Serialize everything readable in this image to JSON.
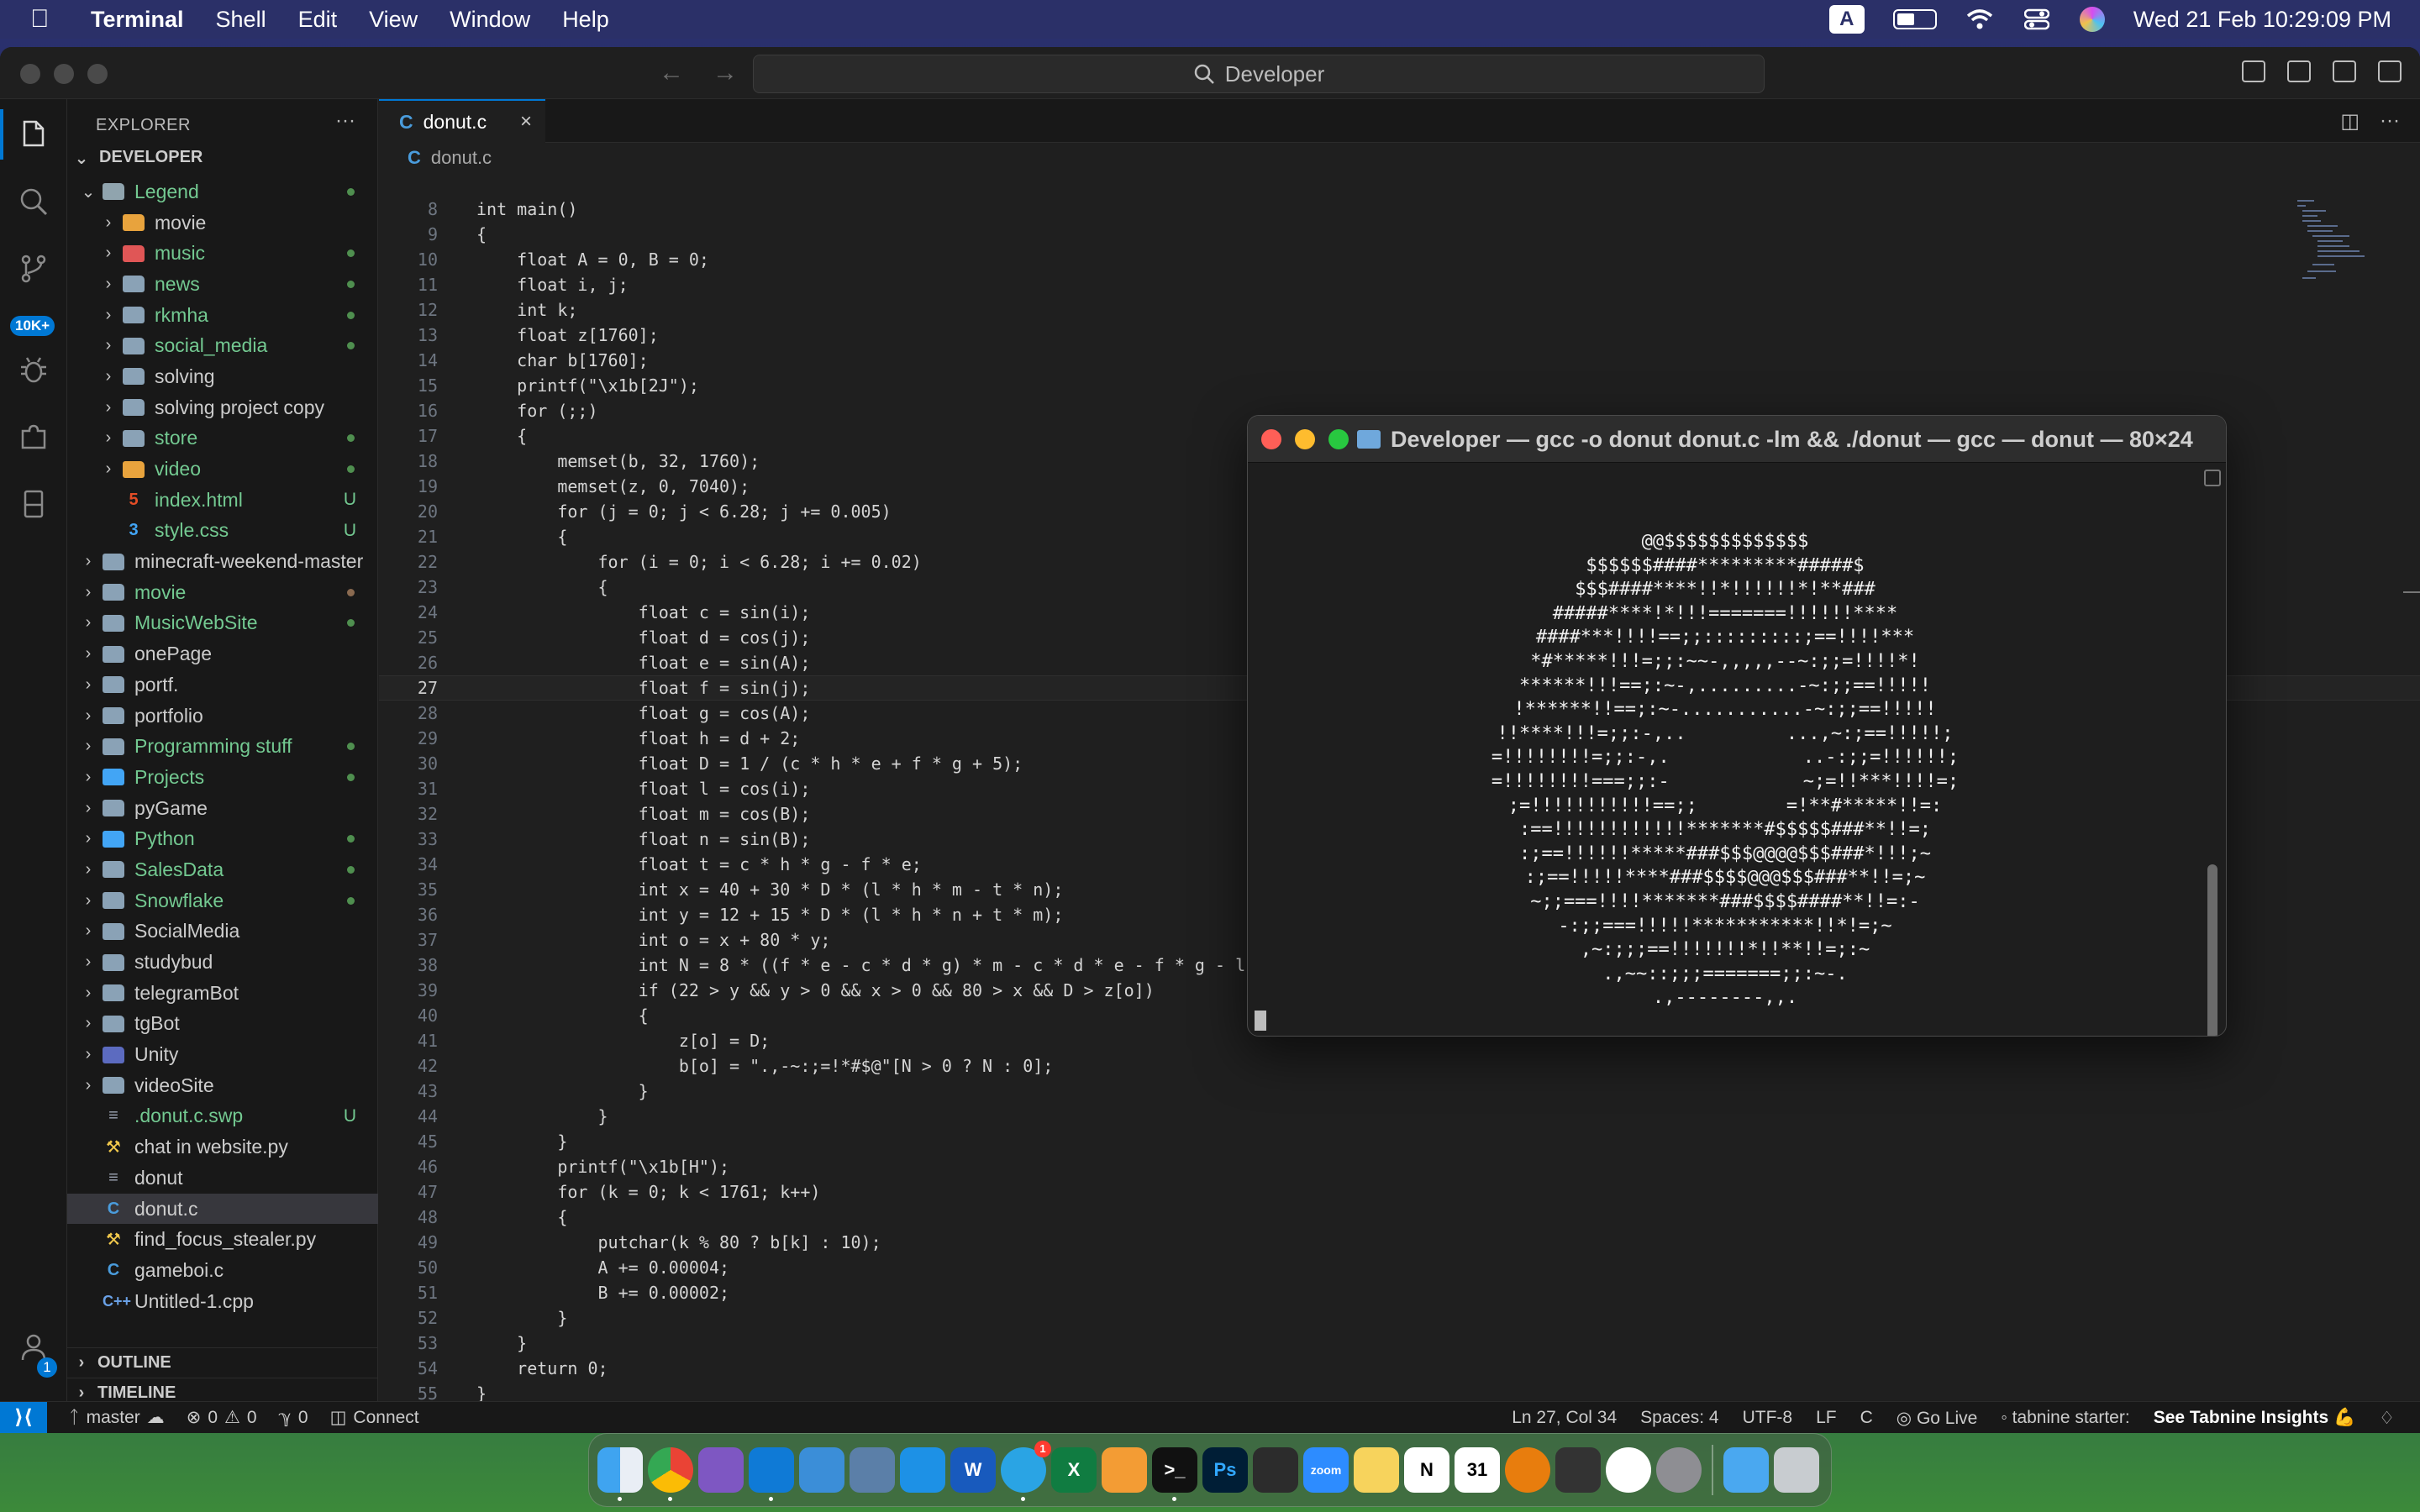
{
  "menubar": {
    "app_name": "Terminal",
    "menus": [
      "Shell",
      "Edit",
      "View",
      "Window",
      "Help"
    ],
    "input_indicator": "A",
    "datetime": "Wed 21 Feb  10:29:09 PM"
  },
  "vscode": {
    "command_center": "Developer",
    "activity_badge": "10K+",
    "accounts_badge": "1",
    "explorer": {
      "header": "EXPLORER",
      "root": "DEVELOPER",
      "items": [
        {
          "name": "Legend",
          "kind": "folder-open",
          "depth": 1,
          "color": "green"
        },
        {
          "name": "movie",
          "kind": "folder",
          "depth": 2,
          "icon": "yellow"
        },
        {
          "name": "music",
          "kind": "folder",
          "depth": 2,
          "icon": "red",
          "color": "green"
        },
        {
          "name": "news",
          "kind": "folder",
          "depth": 2,
          "color": "green"
        },
        {
          "name": "rkmha",
          "kind": "folder",
          "depth": 2,
          "color": "green"
        },
        {
          "name": "social_media",
          "kind": "folder",
          "depth": 2,
          "color": "green"
        },
        {
          "name": "solving",
          "kind": "folder",
          "depth": 2
        },
        {
          "name": "solving project copy",
          "kind": "folder",
          "depth": 2
        },
        {
          "name": "store",
          "kind": "folder",
          "depth": 2,
          "color": "green"
        },
        {
          "name": "video",
          "kind": "folder",
          "depth": 2,
          "icon": "yellow",
          "color": "green"
        },
        {
          "name": "index.html",
          "kind": "html",
          "depth": 2,
          "color": "green",
          "status": "U"
        },
        {
          "name": "style.css",
          "kind": "css",
          "depth": 2,
          "color": "green",
          "status": "U"
        },
        {
          "name": "minecraft-weekend-master",
          "kind": "folder",
          "depth": 1
        },
        {
          "name": "movie",
          "kind": "folder",
          "depth": 1,
          "color": "green",
          "dot": "brown"
        },
        {
          "name": "MusicWebSite",
          "kind": "folder",
          "depth": 1,
          "color": "green"
        },
        {
          "name": "onePage",
          "kind": "folder",
          "depth": 1
        },
        {
          "name": "portf.",
          "kind": "folder",
          "depth": 1
        },
        {
          "name": "portfolio",
          "kind": "folder",
          "depth": 1
        },
        {
          "name": "Programming stuff",
          "kind": "folder",
          "depth": 1,
          "color": "green"
        },
        {
          "name": "Projects",
          "kind": "folder",
          "depth": 1,
          "icon": "blue",
          "color": "green"
        },
        {
          "name": "pyGame",
          "kind": "folder",
          "depth": 1
        },
        {
          "name": "Python",
          "kind": "folder",
          "depth": 1,
          "icon": "blue",
          "color": "green"
        },
        {
          "name": "SalesData",
          "kind": "folder",
          "depth": 1,
          "color": "green"
        },
        {
          "name": "Snowflake",
          "kind": "folder",
          "depth": 1,
          "color": "green"
        },
        {
          "name": "SocialMedia",
          "kind": "folder",
          "depth": 1
        },
        {
          "name": "studybud",
          "kind": "folder",
          "depth": 1
        },
        {
          "name": "telegramBot",
          "kind": "folder",
          "depth": 1
        },
        {
          "name": "tgBot",
          "kind": "folder",
          "depth": 1
        },
        {
          "name": "Unity",
          "kind": "folder",
          "depth": 1,
          "icon": "purple"
        },
        {
          "name": "videoSite",
          "kind": "folder",
          "depth": 1
        },
        {
          "name": ".donut.c.swp",
          "kind": "plain",
          "depth": 1,
          "color": "green",
          "status": "U"
        },
        {
          "name": "chat in website.py",
          "kind": "py",
          "depth": 1
        },
        {
          "name": "donut",
          "kind": "plain",
          "depth": 1
        },
        {
          "name": "donut.c",
          "kind": "c",
          "depth": 1,
          "selected": true
        },
        {
          "name": "find_focus_stealer.py",
          "kind": "py",
          "depth": 1
        },
        {
          "name": "gameboi.c",
          "kind": "c",
          "depth": 1
        },
        {
          "name": "Untitled-1.cpp",
          "kind": "cpp",
          "depth": 1
        }
      ],
      "sections": [
        "OUTLINE",
        "TIMELINE"
      ]
    },
    "tab": {
      "icon": "C",
      "label": "donut.c"
    },
    "breadcrumb": {
      "icon": "C",
      "label": "donut.c"
    },
    "code": {
      "first_line": 8,
      "current_line": 27,
      "lines": [
        "int main()",
        "{",
        "    float A = 0, B = 0;",
        "    float i, j;",
        "    int k;",
        "    float z[1760];",
        "    char b[1760];",
        "    printf(\"\\x1b[2J\");",
        "    for (;;)",
        "    {",
        "        memset(b, 32, 1760);",
        "        memset(z, 0, 7040);",
        "        for (j = 0; j < 6.28; j += 0.005)",
        "        {",
        "            for (i = 0; i < 6.28; i += 0.02)",
        "            {",
        "                float c = sin(i);",
        "                float d = cos(j);",
        "                float e = sin(A);",
        "                float f = sin(j);",
        "                float g = cos(A);",
        "                float h = d + 2;",
        "                float D = 1 / (c * h * e + f * g + 5);",
        "                float l = cos(i);",
        "                float m = cos(B);",
        "                float n = sin(B);",
        "                float t = c * h * g - f * e;",
        "                int x = 40 + 30 * D * (l * h * m - t * n);",
        "                int y = 12 + 15 * D * (l * h * n + t * m);",
        "                int o = x + 80 * y;",
        "                int N = 8 * ((f * e - c * d * g) * m - c * d * e - f * g - l *",
        "                if (22 > y && y > 0 && x > 0 && 80 > x && D > z[o])",
        "                {",
        "                    z[o] = D;",
        "                    b[o] = \".,-~:;=!*#$@\"[N > 0 ? N : 0];",
        "                }",
        "            }",
        "        }",
        "        printf(\"\\x1b[H\");",
        "        for (k = 0; k < 1761; k++)",
        "        {",
        "            putchar(k % 80 ? b[k] : 10);",
        "            A += 0.00004;",
        "            B += 0.00002;",
        "        }",
        "    }",
        "    return 0;",
        "}"
      ]
    },
    "status": {
      "branch": "master",
      "errors": "0",
      "warnings": "0",
      "ports": "0",
      "connect": "Connect",
      "position": "Ln 27, Col 34",
      "spaces": "Spaces: 4",
      "encoding": "UTF-8",
      "eol": "LF",
      "language": "C",
      "golive": "Go Live",
      "tabnine": "tabnine starter:",
      "tabnine_insights": "See Tabnine Insights 💪"
    }
  },
  "terminal": {
    "title": "Developer — gcc -o donut donut.c -lm && ./donut — gcc — donut — 80×24",
    "output": [
      "@@$$$$$$$$$$$$$",
      "$$$$$$####*********#####$",
      "$$$####****!!*!!!!!!*!**###",
      "#####****!*!!!=======!!!!!!****",
      "####***!!!!==;;:::::::::;==!!!!***",
      "*#*****!!!=;;:~~-,,,,,--~:;;=!!!!*!",
      "******!!!==;:~-,.........-~:;;==!!!!!",
      "!******!!==;:~-...........-~:;;==!!!!!",
      "!!****!!!=;;:-,..         ...,~:;==!!!!!;",
      "=!!!!!!!!=;;:-,.            ..-:;;=!!!!!!;",
      "=!!!!!!!!===;;:-            ~;=!!***!!!!=;",
      ";=!!!!!!!!!!!==;;        =!**#*****!!=:",
      ":==!!!!!!!!!!!!*******#$$$$$###**!!=;",
      ":;==!!!!!!*****###$$$@@@@$$$###*!!!;~",
      ":;==!!!!!****###$$$$@@@$$$###**!!=;~",
      "~;;===!!!!*******###$$$$####**!!=:-",
      "-:;;===!!!!!***********!!*!=;~",
      ",~:;;;==!!!!!!!*!!**!!=;:~",
      ".,~~::;;;=======;;:~-.",
      ".,--------,,."
    ]
  },
  "dock": {
    "apps": [
      "Finder",
      "Google Chrome",
      "Visual Studio",
      "Visual Studio Code",
      "Xcode Instruments",
      "Dia",
      "Docker",
      "Microsoft Word",
      "Telegram",
      "Microsoft Excel",
      "Sublime Text",
      "Terminal",
      "Photoshop",
      "Final Cut Pro",
      "Zoom",
      "Notes",
      "Notion",
      "Calendar",
      "Blender",
      "Unity Hub",
      "Clock",
      "System Settings",
      "Downloads",
      "Trash"
    ],
    "telegram_badge": "1",
    "calendar_day": "31",
    "zoom_label": "zoom",
    "ps_label": "Ps"
  }
}
